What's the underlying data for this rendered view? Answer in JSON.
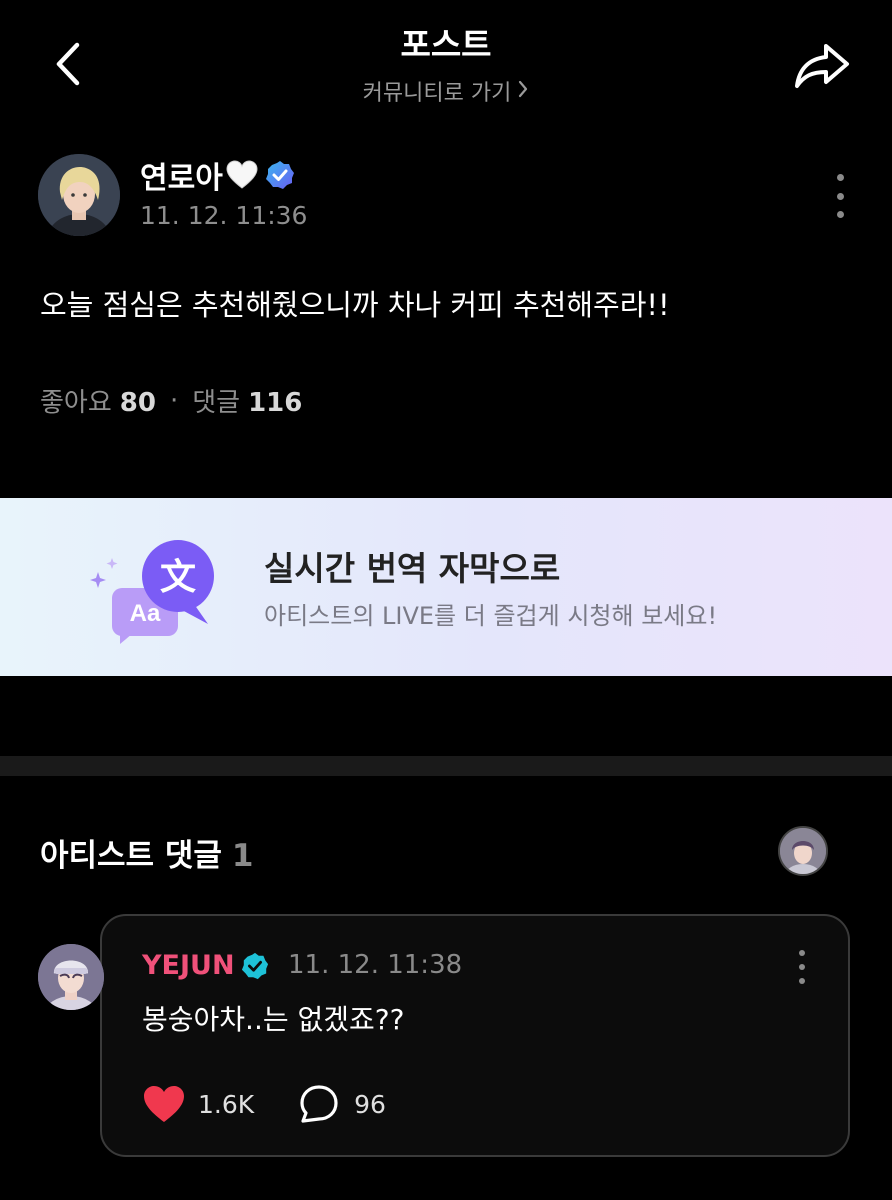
{
  "header": {
    "title": "포스트",
    "subtitle": "커뮤니티로 가기",
    "back_icon": "chevron-left-icon",
    "share_icon": "share-arrow-icon"
  },
  "post": {
    "author": "연로아",
    "author_emoji": "white-heart-icon",
    "verified_icon": "verified-badge-icon",
    "time": "11. 12. 11:36",
    "body": "오늘 점심은 추천해줬으니까 차나 커피 추천해주라!!",
    "likes_label": "좋아요",
    "likes_count": "80",
    "separator": "·",
    "comments_label": "댓글",
    "comments_count": "116"
  },
  "banner": {
    "title": "실시간 번역 자막으로",
    "subtitle": "아티스트의 LIVE를 더 즐겁게 시청해 보세요!",
    "icon_glyph_main": "文",
    "icon_glyph_sub": "Aa",
    "colors": {
      "bubble_purple": "#7b5cf5",
      "bubble_light": "#b99cf7"
    }
  },
  "artist_comments": {
    "title": "아티스트 댓글",
    "count": "1",
    "comment": {
      "author": "YEJUN",
      "time": "11. 12. 11:38",
      "text": "봉숭아차..는 없겠죠??",
      "likes": "1.6K",
      "replies": "96"
    }
  },
  "colors": {
    "background": "#000000",
    "accent_name": "#f0517a",
    "verified": "#1ec2d8",
    "heart": "#f0384e"
  }
}
